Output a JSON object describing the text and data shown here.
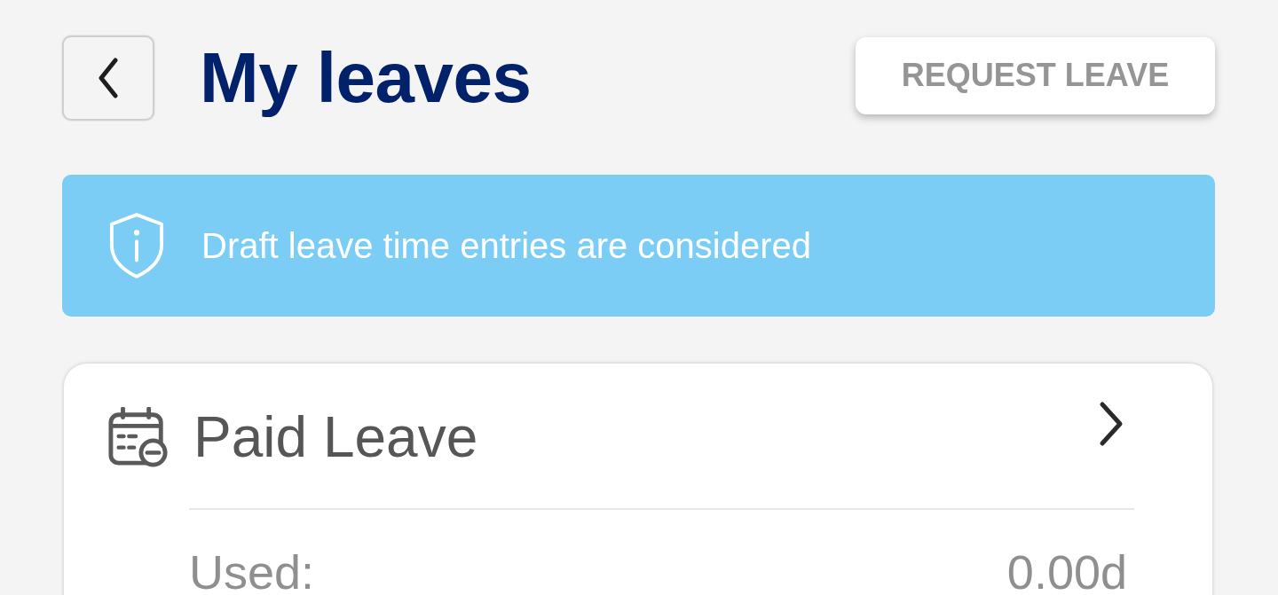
{
  "header": {
    "title": "My leaves",
    "action_button": "REQUEST LEAVE"
  },
  "notice": {
    "text": "Draft leave time entries are considered"
  },
  "leave_cards": [
    {
      "title": "Paid Leave",
      "rows": [
        {
          "label": "Used:",
          "value": "0.00d"
        }
      ]
    }
  ]
}
